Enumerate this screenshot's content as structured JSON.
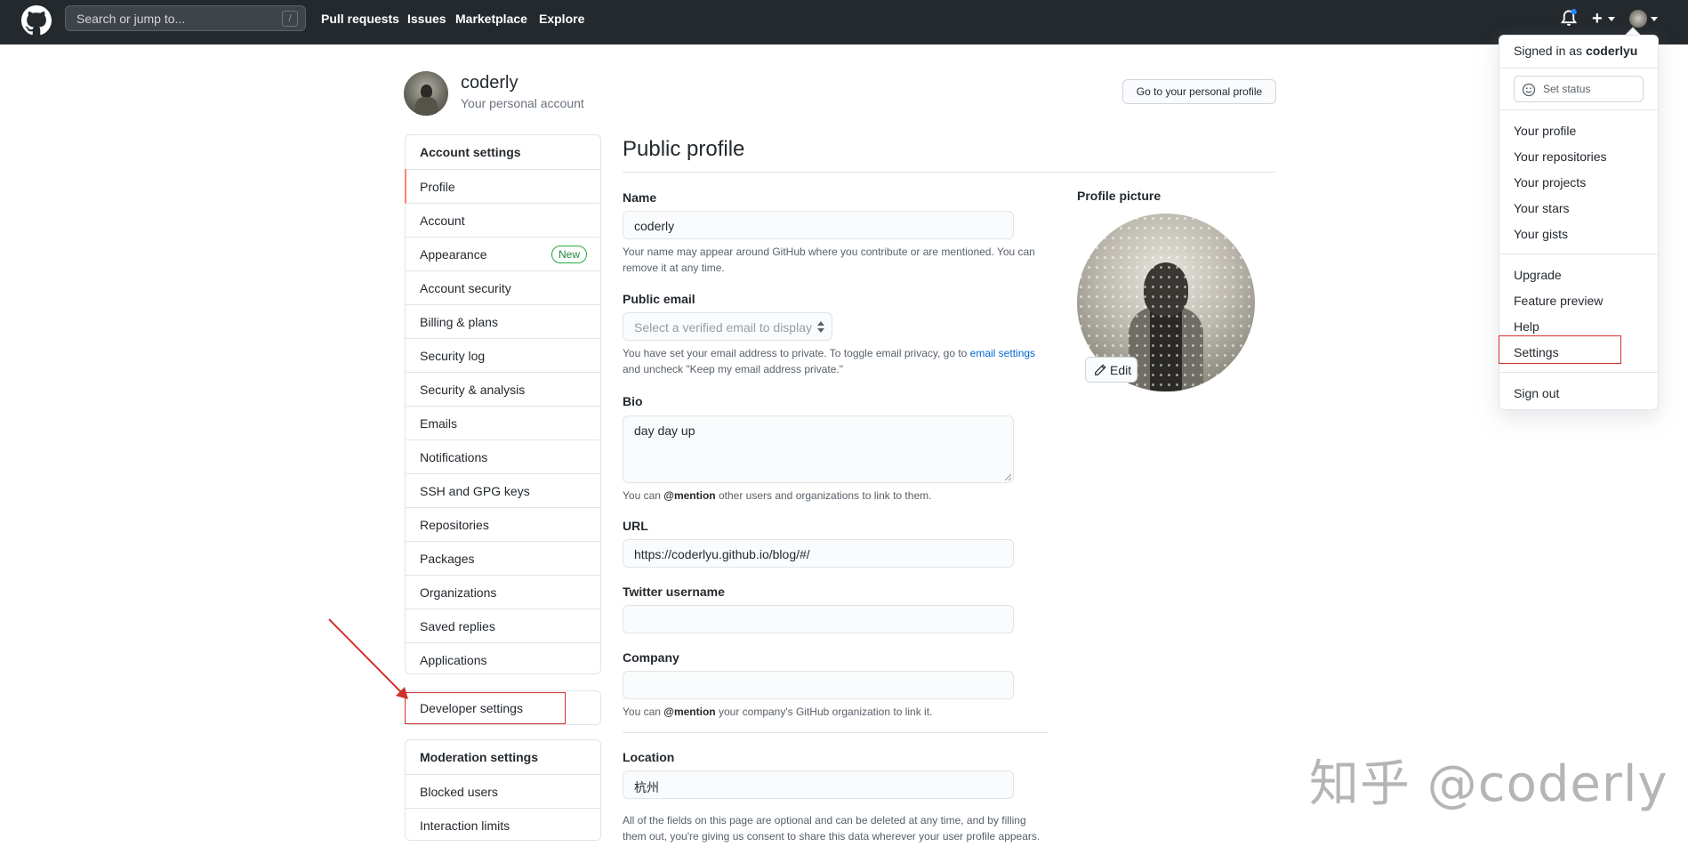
{
  "header": {
    "search_placeholder": "Search or jump to...",
    "search_shortcut": "/",
    "nav": [
      "Pull requests",
      "Issues",
      "Marketplace",
      "Explore"
    ],
    "plus": "+"
  },
  "account": {
    "name": "coderly",
    "subtitle": "Your personal account",
    "profile_button": "Go to your personal profile"
  },
  "sidebar": {
    "heading": "Account settings",
    "items": [
      {
        "label": "Profile",
        "selected": true
      },
      {
        "label": "Account"
      },
      {
        "label": "Appearance",
        "badge": "New"
      },
      {
        "label": "Account security"
      },
      {
        "label": "Billing & plans"
      },
      {
        "label": "Security log"
      },
      {
        "label": "Security & analysis"
      },
      {
        "label": "Emails"
      },
      {
        "label": "Notifications"
      },
      {
        "label": "SSH and GPG keys"
      },
      {
        "label": "Repositories"
      },
      {
        "label": "Packages"
      },
      {
        "label": "Organizations"
      },
      {
        "label": "Saved replies"
      },
      {
        "label": "Applications"
      }
    ],
    "developer": "Developer settings",
    "moderation_heading": "Moderation settings",
    "moderation_items": [
      "Blocked users",
      "Interaction limits"
    ]
  },
  "main": {
    "title": "Public profile",
    "name_label": "Name",
    "name_value": "coderly",
    "name_note": "Your name may appear around GitHub where you contribute or are mentioned. You can remove it at any time.",
    "email_label": "Public email",
    "email_placeholder": "Select a verified email to display",
    "email_note_1": "You have set your email address to private. To toggle email privacy, go to ",
    "email_note_link": "email settings",
    "email_note_2": " and uncheck \"Keep my email address private.\"",
    "bio_label": "Bio",
    "bio_value": "day day up",
    "bio_note_1": "You can ",
    "bio_note_mention": "@mention",
    "bio_note_2": " other users and organizations to link to them.",
    "url_label": "URL",
    "url_value": "https://coderlyu.github.io/blog/#/",
    "twitter_label": "Twitter username",
    "twitter_value": "",
    "company_label": "Company",
    "company_value": "",
    "company_note_1": "You can ",
    "company_note_mention": "@mention",
    "company_note_2": " your company's GitHub organization to link it.",
    "location_label": "Location",
    "location_value": "杭州",
    "footer_note": "All of the fields on this page are optional and can be deleted at any time, and by filling them out, you're giving us consent to share this data wherever your user profile appears.",
    "picture_label": "Profile picture",
    "edit_label": "Edit"
  },
  "dropdown": {
    "signed_in_prefix": "Signed in as ",
    "username": "coderlyu",
    "set_status": "Set status",
    "group1": [
      "Your profile",
      "Your repositories",
      "Your projects",
      "Your stars",
      "Your gists"
    ],
    "group2": [
      "Upgrade",
      "Feature preview",
      "Help",
      "Settings"
    ],
    "sign_out": "Sign out"
  },
  "watermark": "知乎 @coderly",
  "colors": {
    "header_bg": "#24292e",
    "accent_selected": "#f9826c",
    "annotation_red": "#d0312d",
    "new_badge": "#28a745"
  }
}
